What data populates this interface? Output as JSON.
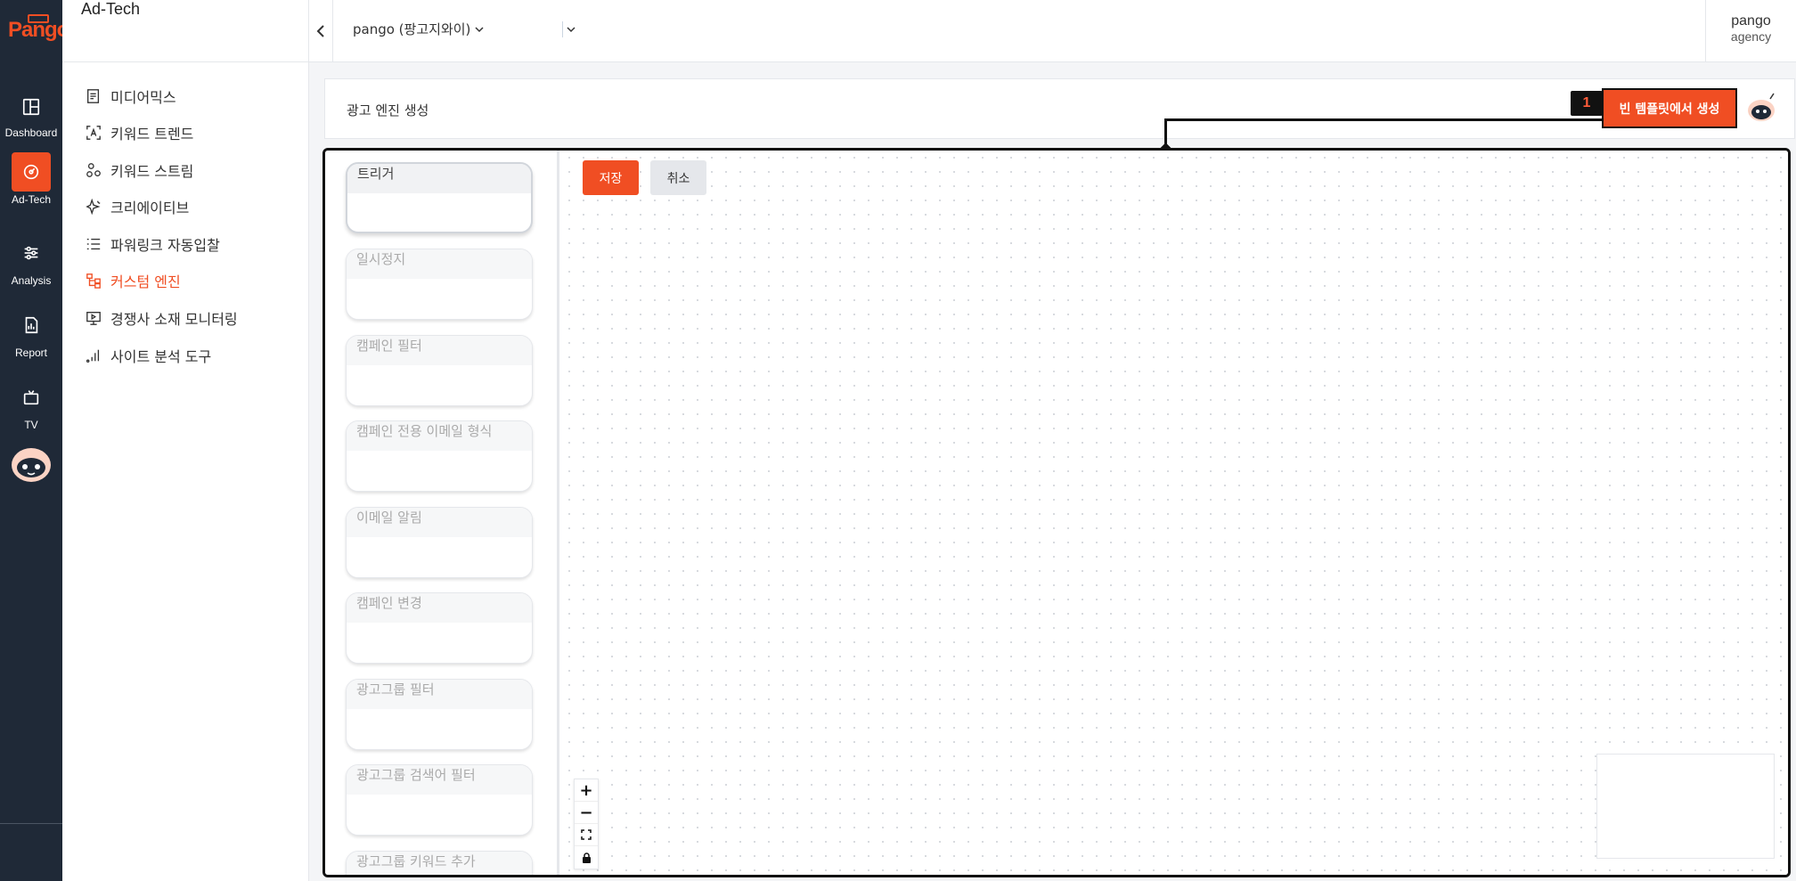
{
  "brand": {
    "logo_text": "Pango",
    "accent": "#f04e23",
    "rail_bg": "#1f2937"
  },
  "rail": {
    "items": [
      {
        "label": "Dashboard",
        "icon": "layout-icon",
        "active": false
      },
      {
        "label": "Ad-Tech",
        "icon": "target-icon",
        "active": true
      },
      {
        "label": "Analysis",
        "icon": "sliders-icon",
        "active": false
      },
      {
        "label": "Report",
        "icon": "report-icon",
        "active": false
      },
      {
        "label": "TV",
        "icon": "tv-icon",
        "active": false
      }
    ],
    "assistant_icon": "robot-avatar-icon"
  },
  "sidebar": {
    "title": "Ad-Tech",
    "items": [
      {
        "label": "미디어믹스",
        "icon": "document-icon"
      },
      {
        "label": "키워드 트렌드",
        "icon": "text-scan-icon"
      },
      {
        "label": "키워드 스트림",
        "icon": "nodes-icon"
      },
      {
        "label": "크리에이티브",
        "icon": "sparkle-icon"
      },
      {
        "label": "파워링크 자동입찰",
        "icon": "list-icon"
      },
      {
        "label": "커스텀 엔진",
        "icon": "flow-icon",
        "active": true
      },
      {
        "label": "경쟁사 소재 모니터링",
        "icon": "monitor-icon"
      },
      {
        "label": "사이트 분석 도구",
        "icon": "bar-chart-icon"
      }
    ]
  },
  "topbar": {
    "account": "pango (팡고지와이)",
    "user_name": "pango",
    "user_role": "agency"
  },
  "header": {
    "title": "광고 엔진 생성",
    "step_number": "1",
    "create_button": "빈 템플릿에서 생성"
  },
  "editor": {
    "save_label": "저장",
    "cancel_label": "취소",
    "nodes": [
      "트리거",
      "일시정지",
      "캠페인 필터",
      "캠페인 전용 이메일 형식",
      "이메일 알림",
      "캠페인 변경",
      "광고그룹 필터",
      "광고그룹 검색어 필터",
      "광고그룹 키워드 추가"
    ],
    "zoom_controls": [
      "+",
      "−"
    ]
  }
}
